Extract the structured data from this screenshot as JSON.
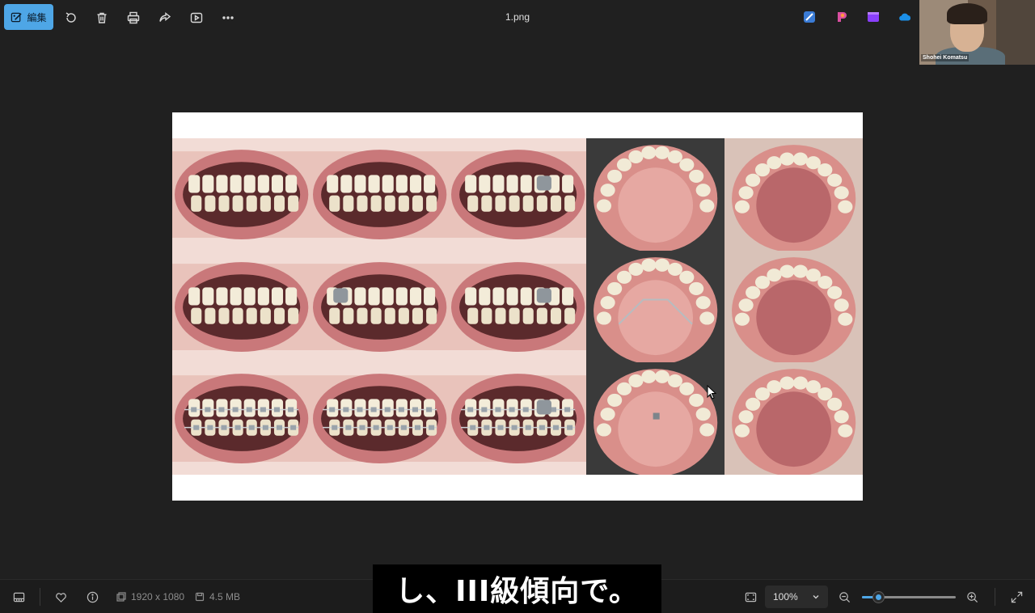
{
  "toolbar": {
    "edit_label": "編集",
    "file_name": "1.png"
  },
  "webcam": {
    "participant_name": "Shohei Komatsu"
  },
  "image_grid": {
    "rows": 3,
    "columns": 5,
    "cells": [
      {
        "row": 1,
        "view": "frontal"
      },
      {
        "row": 1,
        "view": "right-lateral"
      },
      {
        "row": 1,
        "view": "left-lateral"
      },
      {
        "row": 1,
        "view": "upper-occlusal"
      },
      {
        "row": 1,
        "view": "lower-occlusal"
      },
      {
        "row": 2,
        "view": "frontal"
      },
      {
        "row": 2,
        "view": "right-lateral"
      },
      {
        "row": 2,
        "view": "left-lateral"
      },
      {
        "row": 2,
        "view": "upper-occlusal"
      },
      {
        "row": 2,
        "view": "lower-occlusal"
      },
      {
        "row": 3,
        "view": "frontal"
      },
      {
        "row": 3,
        "view": "right-lateral"
      },
      {
        "row": 3,
        "view": "left-lateral"
      },
      {
        "row": 3,
        "view": "upper-occlusal"
      },
      {
        "row": 3,
        "view": "lower-occlusal"
      }
    ]
  },
  "statusbar": {
    "dimensions": "1920 x 1080",
    "file_size": "4.5 MB",
    "zoom_level": "100%",
    "zoom_fraction": 0.17
  },
  "subtitle": {
    "text": "し、III級傾向で。"
  },
  "colors": {
    "accent": "#4ea6e6",
    "background": "#202020"
  }
}
